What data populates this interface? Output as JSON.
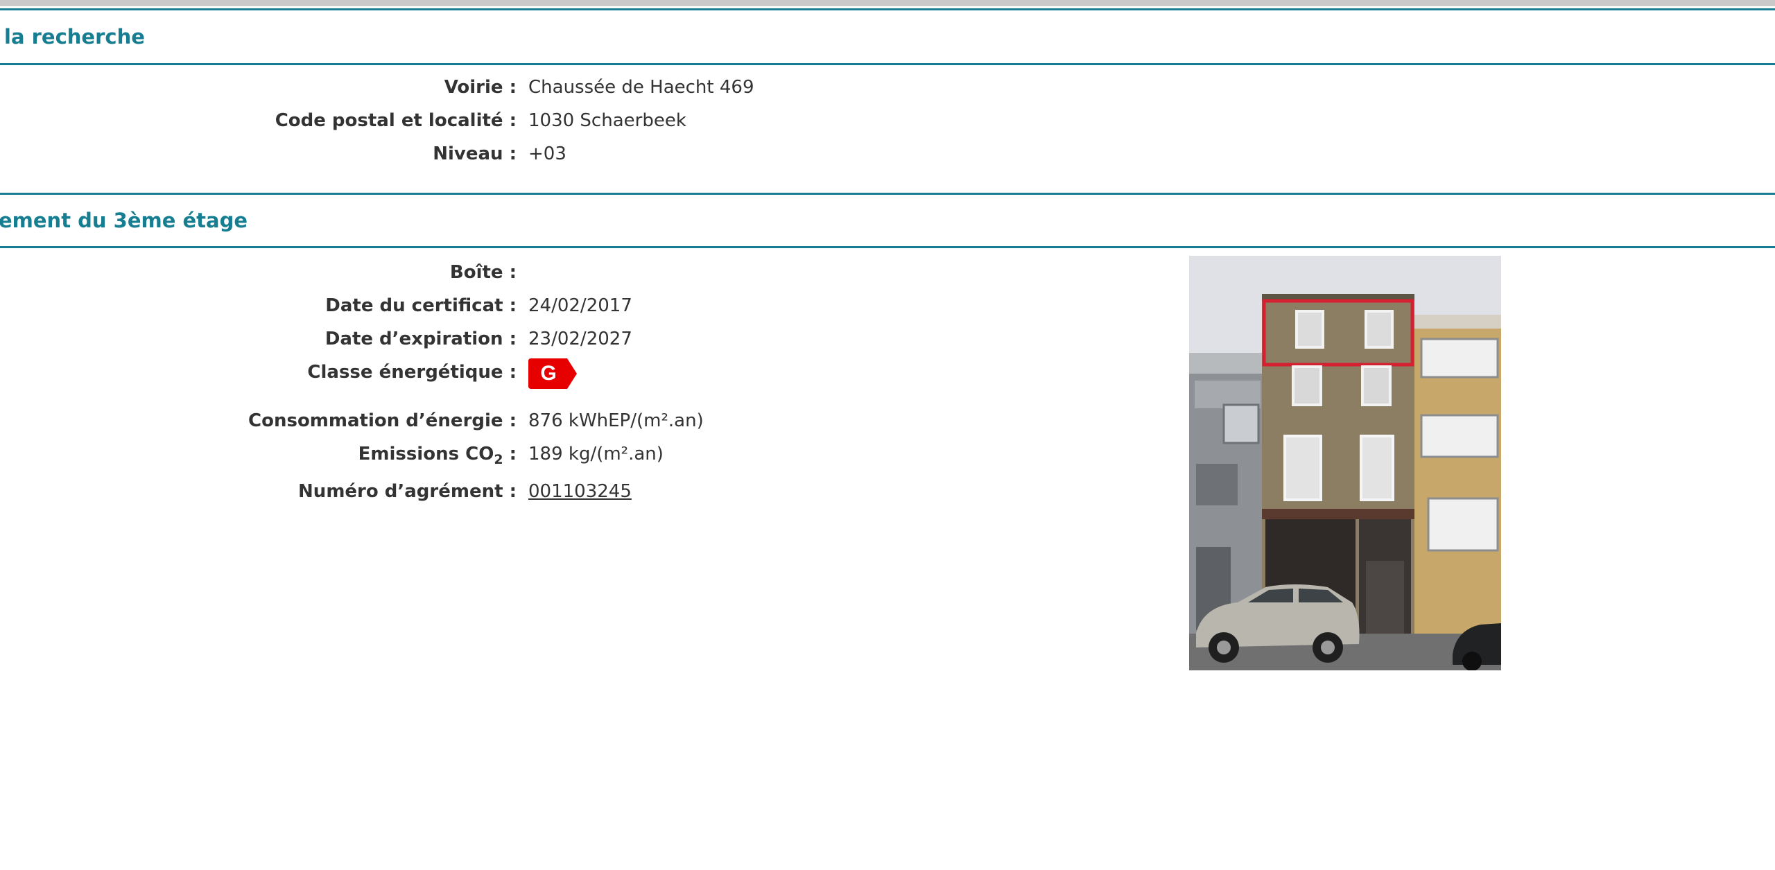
{
  "header1": {
    "title": "la recherche"
  },
  "address": {
    "voirie_label": "Voirie :",
    "voirie_value": "Chaussée de Haecht 469",
    "postal_label": "Code postal et localité :",
    "postal_value": "1030 Schaerbeek",
    "niveau_label": "Niveau :",
    "niveau_value": "+03"
  },
  "header2": {
    "title": "ement du 3ème étage"
  },
  "certificate": {
    "boite_label": "Boîte :",
    "boite_value": "",
    "date_cert_label": "Date du certificat :",
    "date_cert_value": "24/02/2017",
    "date_exp_label": "Date d’expiration :",
    "date_exp_value": "23/02/2027",
    "classe_label": "Classe énergétique :",
    "classe_value": "G",
    "classe_color": "#e60000",
    "conso_label": "Consommation d’énergie :",
    "conso_value": "876 kWhEP/(m².an)",
    "emissions_label_main": "Emissions CO",
    "emissions_label_sub": "2",
    "emissions_label_end": " :",
    "emissions_value": "189 kg/(m².an)",
    "agrement_label": "Numéro d’agrément :",
    "agrement_value": "001103245"
  },
  "colors": {
    "accent": "#177e91",
    "text": "#333333",
    "badge": "#e60000"
  }
}
